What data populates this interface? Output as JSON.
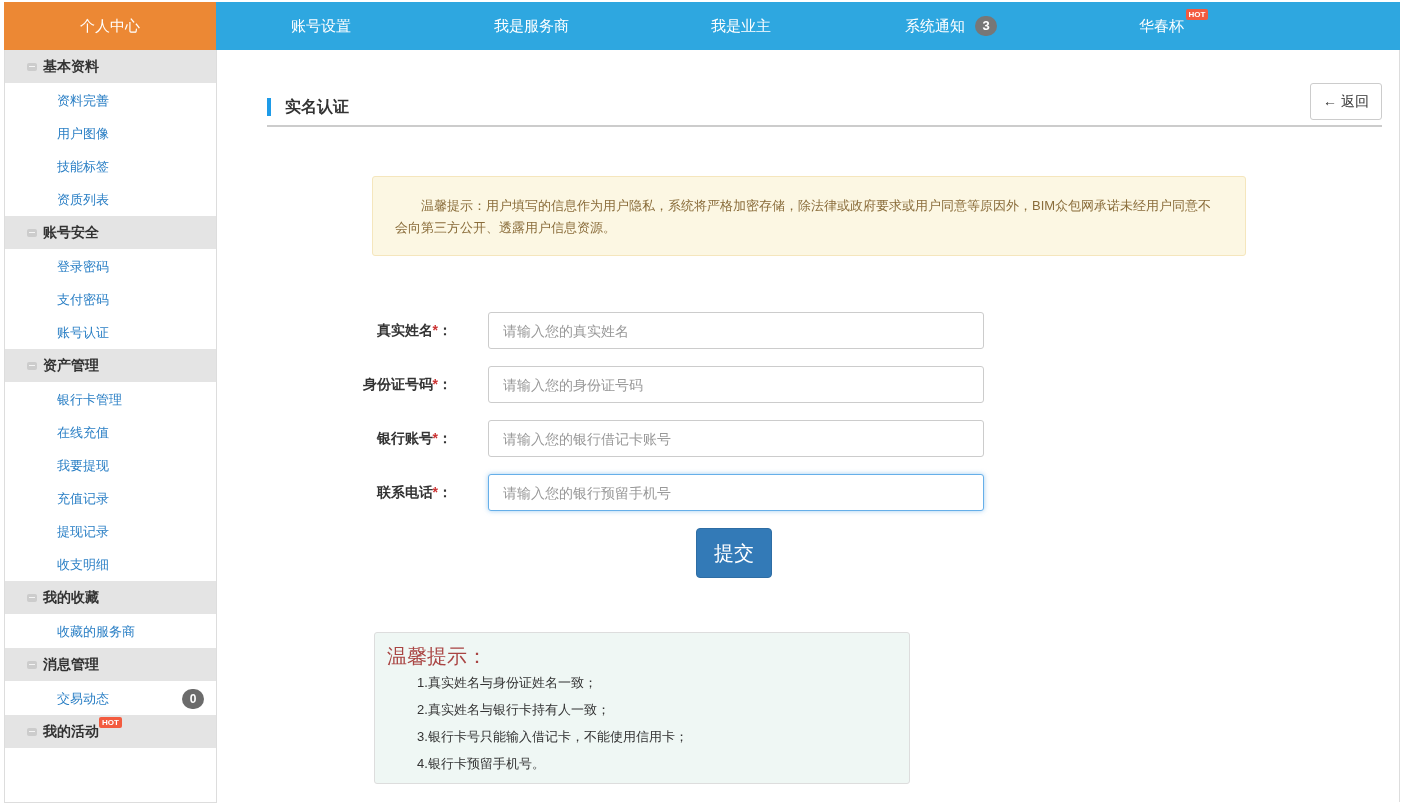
{
  "nav": {
    "items": [
      {
        "label": "个人中心",
        "selected": true
      },
      {
        "label": "账号设置",
        "selected": false
      },
      {
        "label": "我是服务商",
        "selected": false
      },
      {
        "label": "我是业主",
        "selected": false
      },
      {
        "label": "系统通知",
        "selected": false,
        "badge": "3"
      },
      {
        "label": "华春杯",
        "selected": false,
        "hot": "HOT"
      }
    ]
  },
  "sidebar": {
    "groups": [
      {
        "title": "基本资料",
        "items": [
          {
            "label": "资料完善"
          },
          {
            "label": "用户图像"
          },
          {
            "label": "技能标签"
          },
          {
            "label": "资质列表"
          }
        ]
      },
      {
        "title": "账号安全",
        "items": [
          {
            "label": "登录密码"
          },
          {
            "label": "支付密码"
          },
          {
            "label": "账号认证"
          }
        ]
      },
      {
        "title": "资产管理",
        "items": [
          {
            "label": "银行卡管理"
          },
          {
            "label": "在线充值"
          },
          {
            "label": "我要提现"
          },
          {
            "label": "充值记录"
          },
          {
            "label": "提现记录"
          },
          {
            "label": "收支明细"
          }
        ]
      },
      {
        "title": "我的收藏",
        "items": [
          {
            "label": "收藏的服务商"
          }
        ]
      },
      {
        "title": "消息管理",
        "items": [
          {
            "label": "交易动态",
            "badge": "0"
          }
        ]
      },
      {
        "title": "我的活动",
        "hot": "HOT"
      }
    ]
  },
  "page": {
    "title": "实名认证",
    "back_button": "← 返回",
    "notice": "温馨提示：用户填写的信息作为用户隐私，系统将严格加密存储，除法律或政府要求或用户同意等原因外，BIM众包网承诺未经用户同意不会向第三方公开、透露用户信息资源。",
    "form": {
      "fields": [
        {
          "label": "真实姓名",
          "required_mark": "*",
          "colon": "：",
          "placeholder": "请输入您的真实姓名",
          "focused": false
        },
        {
          "label": "身份证号码",
          "required_mark": "*",
          "colon": "：",
          "placeholder": "请输入您的身份证号码",
          "focused": false
        },
        {
          "label": "银行账号",
          "required_mark": "*",
          "colon": "：",
          "placeholder": "请输入您的银行借记卡账号",
          "focused": false
        },
        {
          "label": "联系电话",
          "required_mark": "*",
          "colon": "：",
          "placeholder": "请输入您的银行预留手机号",
          "focused": true
        }
      ],
      "submit": "提交"
    },
    "tips": {
      "title": "温馨提示：",
      "items": [
        "1.真实姓名与身份证姓名一致；",
        "2.真实姓名与银行卡持有人一致；",
        "3.银行卡号只能输入借记卡，不能使用信用卡；",
        "4.银行卡预留手机号。"
      ]
    }
  }
}
